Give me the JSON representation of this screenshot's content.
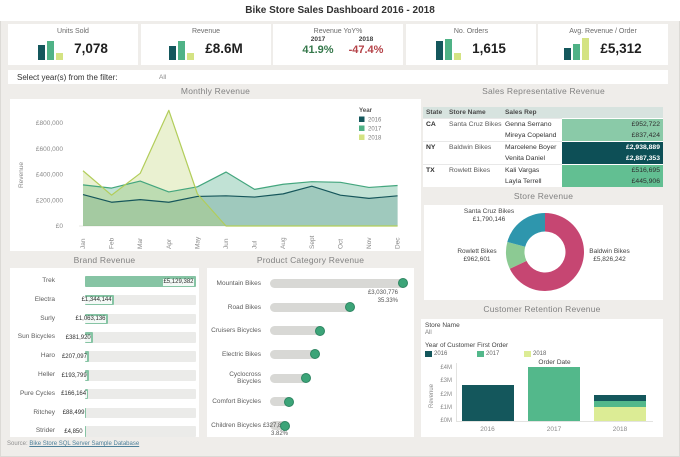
{
  "title": "Bike Store Sales Dashboard 2016 - 2018",
  "colors": {
    "dark_teal": "#14575c",
    "green": "#4fb286",
    "light_green": "#d4e383",
    "pos_green": "#35784b",
    "neg_red": "#b54248",
    "brand_bar": "#86c4a4",
    "dot_green": "#3ca478",
    "donut_pink": "#c64672",
    "donut_teal": "#2e96ad",
    "donut_light_green": "#8cca93"
  },
  "kpis": [
    {
      "label": "Units Sold",
      "value": "7,078",
      "bars": [
        15,
        19,
        7
      ]
    },
    {
      "label": "Revenue",
      "value": "£8.6M",
      "bars": [
        14,
        19,
        7.5
      ]
    },
    {
      "label": "Revenue YoY%",
      "cols": [
        {
          "year": "2017",
          "pct": "41.9%",
          "dir": "pos"
        },
        {
          "year": "2018",
          "pct": "-47.4%",
          "dir": "neg"
        }
      ]
    },
    {
      "label": "No. Orders",
      "value": "1,615",
      "bars": [
        19,
        21,
        7
      ]
    },
    {
      "label": "Avg. Revenue / Order",
      "value": "£5,312",
      "bars": [
        12,
        16.5,
        22
      ]
    }
  ],
  "filter": {
    "label": "Select year(s) from the filter:",
    "value": "All"
  },
  "footer": {
    "prefix": "Source:",
    "link_text": "Bike Store SQL Server Sample Database"
  },
  "chart_data": [
    {
      "id": "monthly_revenue",
      "type": "area",
      "title": "Monthly Revenue",
      "ylabel": "Revenue",
      "x": [
        "Jan",
        "Feb",
        "Mar",
        "Apr",
        "May",
        "Jun",
        "Jul",
        "Aug",
        "Sept",
        "Oct",
        "Nov",
        "Dec"
      ],
      "yticks": [
        0,
        200000,
        400000,
        600000,
        800000
      ],
      "ytick_labels": [
        "£0",
        "£200,000",
        "£400,000",
        "£600,000",
        "£800,000"
      ],
      "ylim": [
        0,
        930000
      ],
      "legend_title": "Year",
      "legend_position": "top-right",
      "grid": false,
      "series": [
        {
          "name": "2016",
          "color": "#16565b",
          "swatch": "#14575c",
          "fill_opacity": 0.22,
          "values": [
            245000,
            185000,
            205000,
            185000,
            230000,
            235000,
            225000,
            250000,
            310000,
            240000,
            215000,
            235000
          ]
        },
        {
          "name": "2017",
          "color": "#44a67e",
          "swatch": "#4fb286",
          "fill_opacity": 0.33,
          "values": [
            320000,
            295000,
            350000,
            265000,
            305000,
            420000,
            285000,
            325000,
            345000,
            340000,
            300000,
            315000
          ]
        },
        {
          "name": "2018",
          "color": "#b2cd5a",
          "swatch": "#d4e383",
          "fill_opacity": 0.28,
          "values": [
            430000,
            240000,
            410000,
            900000,
            250000,
            0,
            0,
            0,
            0,
            0,
            0,
            0
          ]
        }
      ]
    },
    {
      "id": "sales_rep_revenue",
      "type": "table",
      "title": "Sales Representative Revenue",
      "columns": [
        "State",
        "Store Name",
        "Sales Rep"
      ],
      "rows": [
        {
          "state": "CA",
          "store": "Santa Cruz Bikes",
          "rep": "Genna Serrano",
          "value": "£952,722",
          "bg": "#8acaa8",
          "fg": "#2f2f2f",
          "bold": false,
          "group_start": true
        },
        {
          "state": "",
          "store": "",
          "rep": "Mireya Copeland",
          "value": "£837,424",
          "bg": "#8acaa8",
          "fg": "#2f2f2f",
          "bold": false,
          "group_start": false
        },
        {
          "state": "NY",
          "store": "Baldwin Bikes",
          "rep": "Marcelene Boyer",
          "value": "£2,938,889",
          "bg": "#0d4f56",
          "fg": "#ffffff",
          "bold": true,
          "group_start": true
        },
        {
          "state": "",
          "store": "",
          "rep": "Venita Daniel",
          "value": "£2,887,353",
          "bg": "#0d4f56",
          "fg": "#ffffff",
          "bold": true,
          "group_start": false
        },
        {
          "state": "TX",
          "store": "Rowlett Bikes",
          "rep": "Kali Vargas",
          "value": "£516,695",
          "bg": "#62bf92",
          "fg": "#2f2f2f",
          "bold": false,
          "group_start": true
        },
        {
          "state": "",
          "store": "",
          "rep": "Layla Terrell",
          "value": "£445,906",
          "bg": "#62bf92",
          "fg": "#2f2f2f",
          "bold": false,
          "group_start": false
        }
      ]
    },
    {
      "id": "store_revenue",
      "type": "pie",
      "title": "Store Revenue",
      "donut": true,
      "slices": [
        {
          "label": "Baldwin Bikes",
          "value": 5826242,
          "value_text": "£5,826,242",
          "color": "#c64672"
        },
        {
          "label": "Rowlett Bikes",
          "value": 962601,
          "value_text": "£962,601",
          "color": "#8cca93"
        },
        {
          "label": "Santa Cruz Bikes",
          "value": 1790146,
          "value_text": "£1,790,146",
          "color": "#2e96ad"
        }
      ]
    },
    {
      "id": "brand_revenue",
      "type": "bar",
      "title": "Brand Revenue",
      "orientation": "horizontal",
      "categories": [
        "Trek",
        "Electra",
        "Surly",
        "Sun Bicycles",
        "Haro",
        "Heller",
        "Pure Cycles",
        "Ritchey",
        "Strider"
      ],
      "values": [
        5129382,
        1344144,
        1063136,
        381920,
        207097,
        193799,
        166164,
        88499,
        4850
      ],
      "value_labels": [
        "£5,129,382",
        "£1,344,144",
        "£1,063,136",
        "£381,920",
        "£207,097",
        "£193,799",
        "£166,164",
        "£88,499",
        "£4,850"
      ]
    },
    {
      "id": "product_category_revenue",
      "type": "bar",
      "title": "Product Category Revenue",
      "style": "lollipop",
      "orientation": "horizontal",
      "categories": [
        "Mountain Bikes",
        "Road Bikes",
        "Cruisers Bicycles",
        "Electric Bikes",
        "Cyclocross Bicycles",
        "Comfort Bicycles",
        "Children Bicycles"
      ],
      "percents": [
        35.33,
        21.7,
        13.9,
        12.6,
        10.3,
        5.9,
        3.82
      ],
      "annotations": [
        {
          "index": 0,
          "lines": [
            "£3,030,776",
            "35.33%"
          ]
        },
        {
          "index": 6,
          "lines": [
            "£327,888",
            "3.82%"
          ]
        }
      ]
    },
    {
      "id": "customer_retention_revenue",
      "type": "bar",
      "title": "Customer Retention Revenue",
      "stacked": true,
      "filter_label": "Store Name",
      "filter_value": "All",
      "legend_title": "Year of Customer First Order",
      "legend": [
        {
          "label": "2016",
          "color": "#14575c"
        },
        {
          "label": "2017",
          "color": "#53b88b"
        },
        {
          "label": "2018",
          "color": "#dcec95"
        }
      ],
      "axis_title": "Order Date",
      "ylabel": "Revenue",
      "ytick_labels": [
        "£0M",
        "£1M",
        "£2M",
        "£3M",
        "£4M"
      ],
      "yticks": [
        0,
        1,
        2,
        3,
        4
      ],
      "categories": [
        "2016",
        "2017",
        "2018"
      ],
      "bars": [
        {
          "category": "2016",
          "segments": [
            {
              "year": "2016",
              "value": 2.7,
              "color": "#14575c"
            }
          ]
        },
        {
          "category": "2017",
          "segments": [
            {
              "year": "2017",
              "value": 4.1,
              "color": "#53b88b"
            }
          ]
        },
        {
          "category": "2018",
          "segments": [
            {
              "year": "2018",
              "value": 1.02,
              "color": "#dcec95"
            },
            {
              "year": "2017",
              "value": 0.48,
              "color": "#53b88b"
            },
            {
              "year": "2016",
              "value": 0.5,
              "color": "#14575c"
            }
          ]
        }
      ]
    }
  ]
}
